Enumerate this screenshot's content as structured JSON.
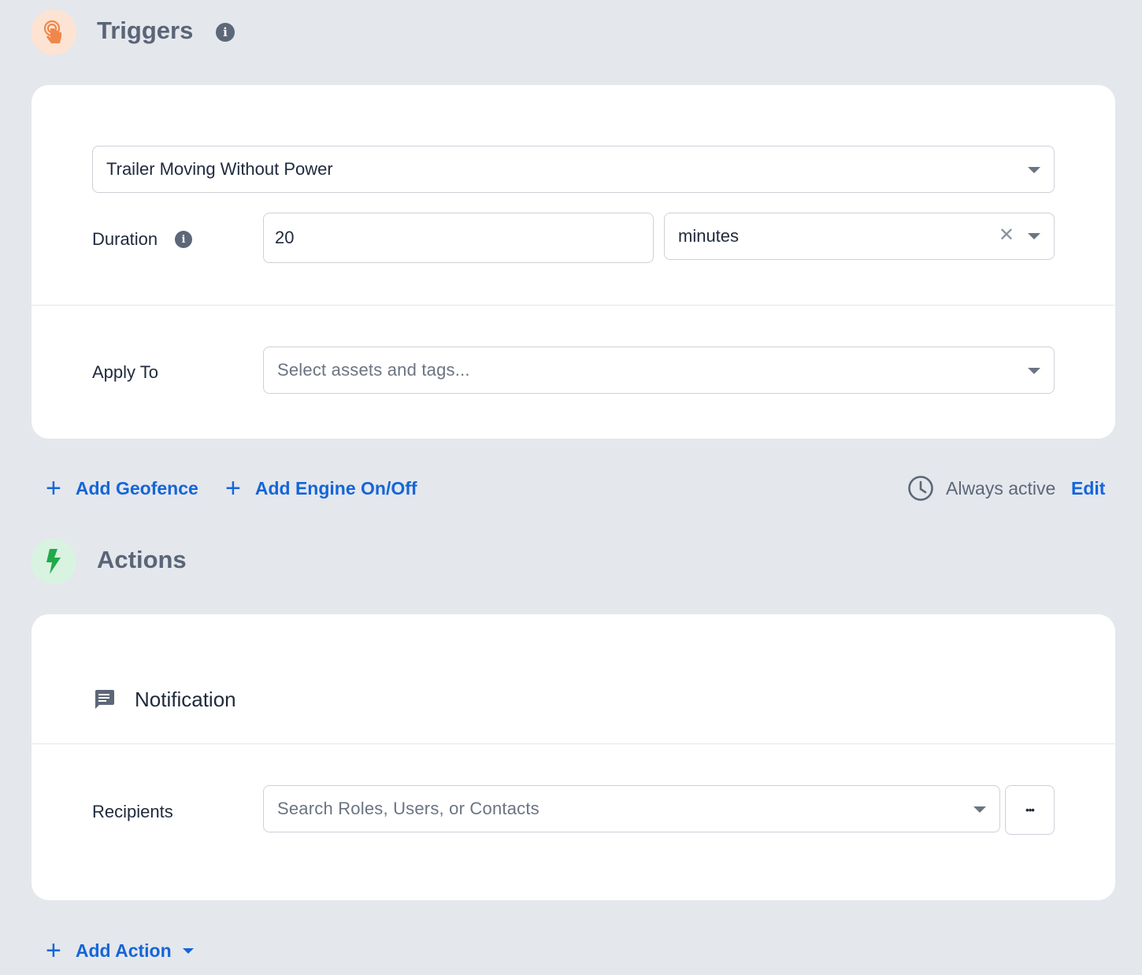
{
  "triggers": {
    "title": "Triggers",
    "trigger_select_value": "Trailer Moving Without Power",
    "duration_label": "Duration",
    "duration_value": "20",
    "duration_unit": "minutes",
    "apply_to_label": "Apply To",
    "apply_to_placeholder": "Select assets and tags...",
    "add_geofence": "Add Geofence",
    "add_engine": "Add Engine On/Off",
    "schedule_text": "Always active",
    "edit_label": "Edit"
  },
  "actions": {
    "title": "Actions",
    "notification_label": "Notification",
    "recipients_label": "Recipients",
    "recipients_placeholder": "Search Roles, Users, or Contacts",
    "more_label": "•••",
    "add_action": "Add Action"
  },
  "colors": {
    "background": "#e4e7ec",
    "link": "#1565d8",
    "trigger_icon_bg": "#fde3d3",
    "trigger_icon": "#f0874a",
    "action_icon_bg": "#d9f3e1",
    "action_icon": "#1faa4a"
  },
  "icons": {
    "trigger": "touch-hand-icon",
    "action": "lightning-bolt-icon",
    "info": "info-icon",
    "notification": "message-bubble-icon",
    "schedule": "clock-icon"
  }
}
